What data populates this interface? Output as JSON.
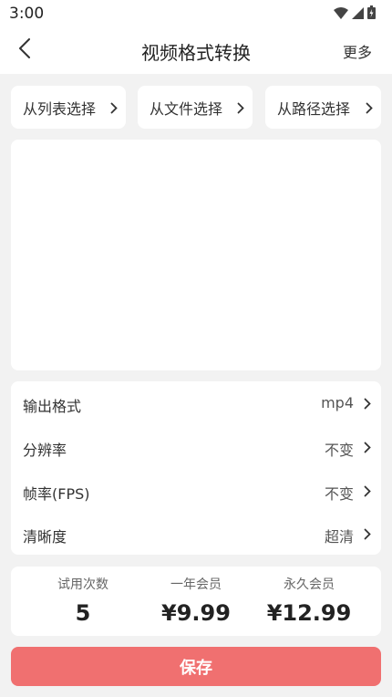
{
  "status_bar": {
    "time": "3:00",
    "icons": [
      "wifi-icon",
      "signal-icon",
      "battery-icon"
    ]
  },
  "header": {
    "title": "视频格式转换",
    "more_label": "更多",
    "back_icon": "chevron-left-icon"
  },
  "source_buttons": [
    {
      "label": "从列表选择"
    },
    {
      "label": "从文件选择"
    },
    {
      "label": "从路径选择"
    }
  ],
  "settings": [
    {
      "label": "输出格式",
      "value": "mp4"
    },
    {
      "label": "分辨率",
      "value": "不变"
    },
    {
      "label": "帧率(FPS)",
      "value": "不变"
    },
    {
      "label": "清晰度",
      "value": "超清"
    }
  ],
  "plans": [
    {
      "label": "试用次数",
      "value": "5"
    },
    {
      "label": "一年会员",
      "value": "¥9.99"
    },
    {
      "label": "永久会员",
      "value": "¥12.99"
    }
  ],
  "save_label": "保存",
  "colors": {
    "background": "#f2f2f2",
    "card": "#ffffff",
    "accent": "#f07070"
  }
}
